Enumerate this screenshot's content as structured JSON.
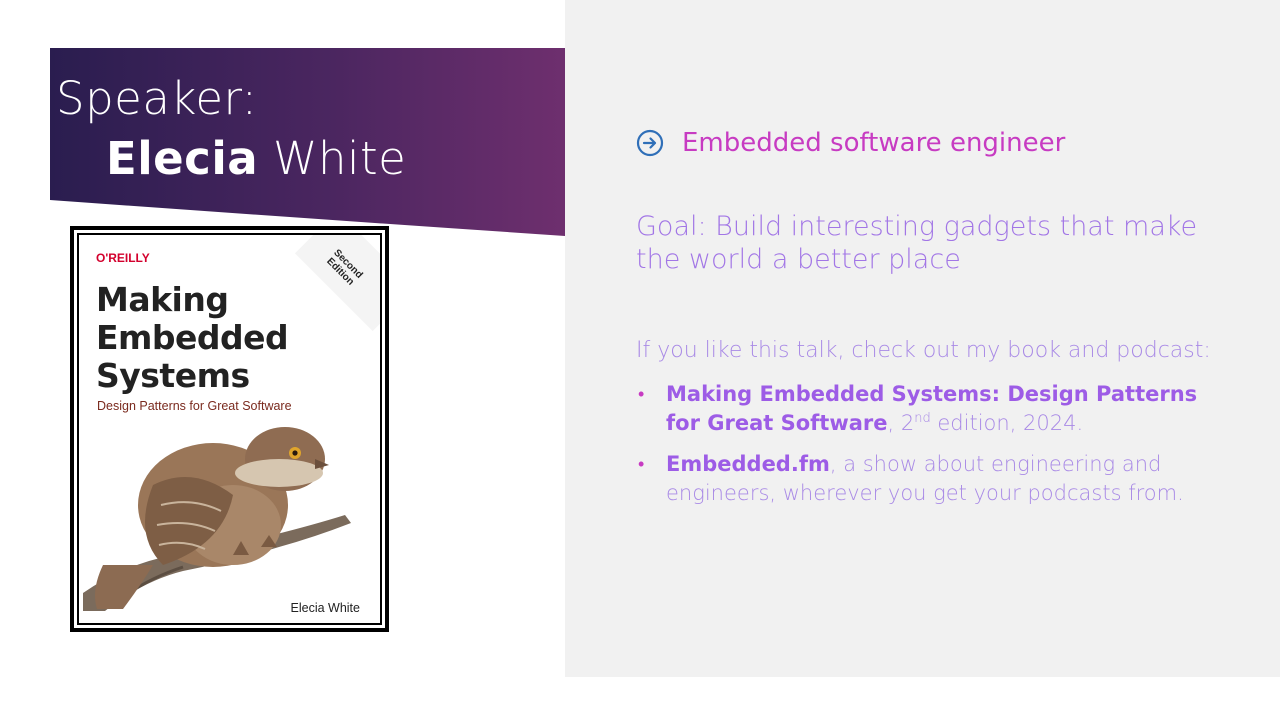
{
  "slide": {
    "title_prefix": "Speaker:",
    "speaker_first": "Elecia",
    "speaker_last": "White"
  },
  "book": {
    "publisher": "O'REILLY",
    "title_line1": "Making",
    "title_line2": "Embedded",
    "title_line3": "Systems",
    "subtitle": "Design Patterns for Great Software",
    "edition_line1": "Second",
    "edition_line2": "Edition",
    "author": "Elecia White"
  },
  "content": {
    "role": "Embedded software engineer",
    "goal": "Goal: Build interesting gadgets that make the world a better place",
    "cta": "If you like this talk, check out my book and podcast:",
    "bullet1_strong": "Making Embedded Systems: Design Patterns for Great Software",
    "bullet1_pre": ", 2",
    "bullet1_sup": "nd",
    "bullet1_rest": " edition, 2024.",
    "bullet2_strong": "Embedded.fm",
    "bullet2_rest": ", a show about engineering and engineers, wherever you get your podcasts from.",
    "bullet_marker": "•"
  },
  "colors": {
    "banner_start": "#2e1e52",
    "banner_end": "#6d2f6e",
    "accent_magenta": "#c73bc2",
    "accent_purple": "#a276e6",
    "panel_gray": "#f1f1f1"
  },
  "icons": {
    "role_icon": "circled-arrow-right-icon"
  }
}
